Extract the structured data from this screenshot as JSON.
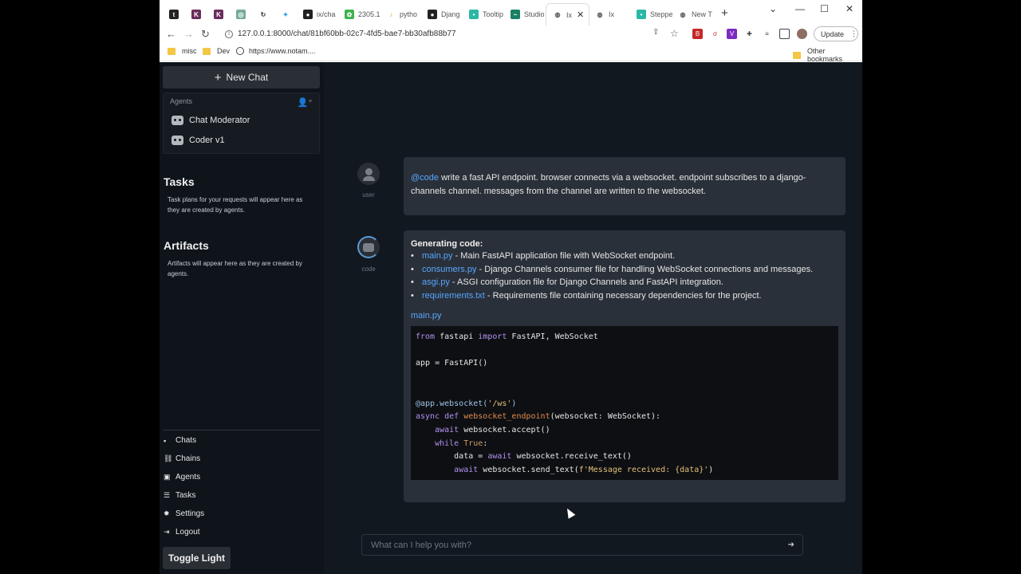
{
  "browser": {
    "tabs": [
      {
        "label": "",
        "icon": "tv-icon",
        "color": "#222"
      },
      {
        "label": "",
        "icon": "k-icon",
        "color": "#6b2d5c"
      },
      {
        "label": "",
        "icon": "k-icon",
        "color": "#6b2d5c"
      },
      {
        "label": "",
        "icon": "chatgpt-icon",
        "color": "#74aa9c"
      },
      {
        "label": "",
        "icon": "refresh-icon",
        "color": "#333"
      },
      {
        "label": "",
        "icon": "twitter-icon",
        "color": "#1d9bf0"
      },
      {
        "label": "ix/cha",
        "icon": "github-icon",
        "color": "#222"
      },
      {
        "label": "2305.1",
        "icon": "arxiv-icon",
        "color": "#3fb34f"
      },
      {
        "label": "pytho",
        "icon": "python-icon",
        "color": "#e8a33d"
      },
      {
        "label": "Djang",
        "icon": "github-icon",
        "color": "#222"
      },
      {
        "label": "Tooltip",
        "icon": "tooltip-icon",
        "color": "#2bb7a6"
      },
      {
        "label": "Studio",
        "icon": "studio-icon",
        "color": "#1a7f64"
      },
      {
        "label": "Ix",
        "icon": "globe-icon",
        "color": "#555"
      },
      {
        "label": "Ix",
        "icon": "globe-icon",
        "color": "#555"
      },
      {
        "label": "Steppe",
        "icon": "stepper-icon",
        "color": "#2bb7a6"
      },
      {
        "label": "New T",
        "icon": "globe-icon",
        "color": "#555"
      }
    ],
    "url": "127.0.0.1:8000/chat/81bf60bb-02c7-4fd5-bae7-bb30afb88b77",
    "update_label": "Update",
    "bookmarks": [
      "misc",
      "Dev",
      "https://www.notam...."
    ],
    "other_bookmarks": "Other bookmarks"
  },
  "sidebar": {
    "new_chat": "New Chat",
    "agents_label": "Agents",
    "agents": [
      "Chat Moderator",
      "Coder v1"
    ],
    "tasks_title": "Tasks",
    "tasks_desc": "Task plans for your requests will appear here as they are created by agents.",
    "artifacts_title": "Artifacts",
    "artifacts_desc": "Artifacts will appear here as they are created by agents.",
    "nav": [
      "Chats",
      "Chains",
      "Agents",
      "Tasks",
      "Settings",
      "Logout"
    ],
    "toggle": "Toggle Light"
  },
  "chat": {
    "user_label": "user",
    "user_mention": "@code",
    "user_message": " write a fast API endpoint. browser connects via a websocket. endpoint subscribes to a django-channels channel. messages from the channel are written to the websocket.",
    "code_label": "code",
    "generating": "Generating code:",
    "files": [
      {
        "name": "main.py",
        "desc": " - Main FastAPI application file with WebSocket endpoint."
      },
      {
        "name": "consumers.py",
        "desc": " - Django Channels consumer file for handling WebSocket connections and messages."
      },
      {
        "name": "asgi.py",
        "desc": " - ASGI configuration file for Django Channels and FastAPI integration."
      },
      {
        "name": "requirements.txt",
        "desc": " - Requirements file containing necessary dependencies for the project."
      }
    ],
    "code_file": "main.py",
    "input_placeholder": "What can I help you with?"
  }
}
